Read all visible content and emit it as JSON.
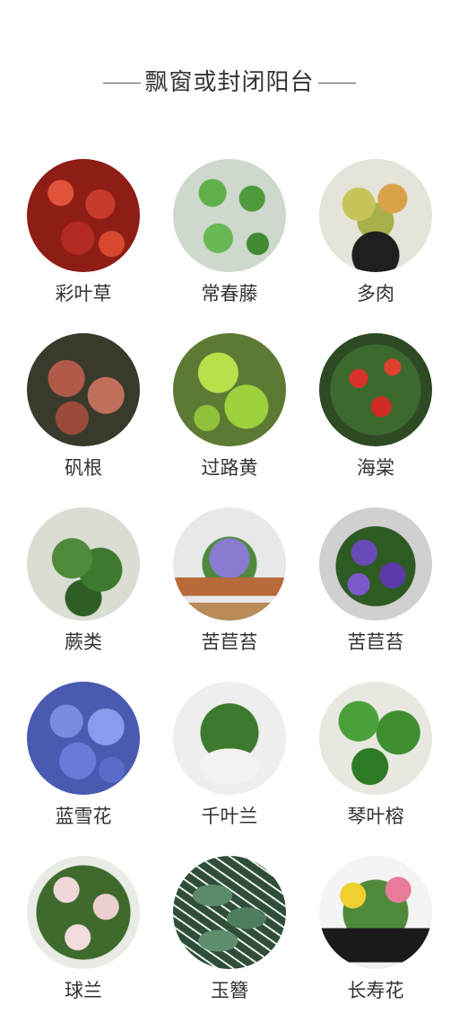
{
  "title": "飘窗或封闭阳台",
  "plants": [
    {
      "name": "彩叶草",
      "icon": "coleus-image"
    },
    {
      "name": "常春藤",
      "icon": "ivy-image"
    },
    {
      "name": "多肉",
      "icon": "succulent-image"
    },
    {
      "name": "矾根",
      "icon": "heuchera-image"
    },
    {
      "name": "过路黄",
      "icon": "lysimachia-image"
    },
    {
      "name": "海棠",
      "icon": "begonia-image"
    },
    {
      "name": "蕨类",
      "icon": "fern-image"
    },
    {
      "name": "苦苣苔",
      "icon": "african-violet-image"
    },
    {
      "name": "苦苣苔",
      "icon": "african-violet-image"
    },
    {
      "name": "蓝雪花",
      "icon": "plumbago-image"
    },
    {
      "name": "千叶兰",
      "icon": "muehlenbeckia-image"
    },
    {
      "name": "琴叶榕",
      "icon": "fiddle-leaf-fig-image"
    },
    {
      "name": "球兰",
      "icon": "hoya-image"
    },
    {
      "name": "玉簪",
      "icon": "hosta-image"
    },
    {
      "name": "长寿花",
      "icon": "kalanchoe-image"
    }
  ]
}
